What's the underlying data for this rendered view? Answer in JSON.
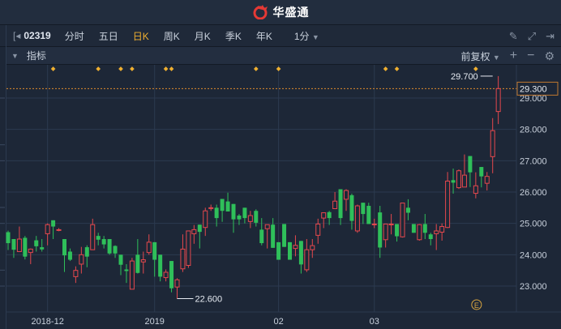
{
  "title": {
    "brand": "华盛通",
    "icon": "huasheng-logo-icon"
  },
  "toolbar": {
    "code": "02319",
    "tabs": [
      "分时",
      "五日",
      "日K",
      "周K",
      "月K",
      "季K",
      "年K"
    ],
    "active_tab": "日K",
    "interval": "1分",
    "icons": [
      "draw-pencil-icon",
      "fullscreen-icon",
      "collapse-panel-icon"
    ]
  },
  "indicator_bar": {
    "label": "指标",
    "adjust": "前复权",
    "icons": [
      "zoom-in-icon",
      "zoom-out-icon",
      "settings-gear-icon"
    ]
  },
  "colors": {
    "up": "#e5484d",
    "down": "#2fbf5a",
    "marker": "#f0b030",
    "bg": "#1d2737"
  },
  "chart_data": {
    "type": "candlestick",
    "ylim": [
      22.4,
      29.85
    ],
    "yticks": [
      "29.000",
      "28.000",
      "27.000",
      "26.000",
      "25.000",
      "24.000",
      "23.000"
    ],
    "ytick_values": [
      29,
      28,
      27,
      26,
      25,
      24,
      23
    ],
    "current_price": "29.300",
    "current_value": 29.3,
    "high_label": "29.700",
    "low_label": "22.600",
    "high_index": 86,
    "low_index": 30,
    "xlabels": [
      {
        "text": "2018-12",
        "index": 7
      },
      {
        "text": "2019",
        "index": 26
      },
      {
        "text": "02",
        "index": 48
      },
      {
        "text": "03",
        "index": 65
      }
    ],
    "event_markers": [
      8,
      16,
      20,
      22,
      28,
      29,
      44,
      48,
      67,
      69,
      83
    ],
    "earnings_marker": {
      "text": "E",
      "index": 83
    },
    "ohlc": [
      [
        24.72,
        24.77,
        24.15,
        24.37
      ],
      [
        24.5,
        24.5,
        23.9,
        24.16
      ],
      [
        24.1,
        24.9,
        24.1,
        24.5
      ],
      [
        24.54,
        24.6,
        23.85,
        23.94
      ],
      [
        24.07,
        24.2,
        23.7,
        24.18
      ],
      [
        24.46,
        24.6,
        24.1,
        24.27
      ],
      [
        24.24,
        24.5,
        24.1,
        24.17
      ],
      [
        24.67,
        25.0,
        24.3,
        24.96
      ],
      [
        25.1,
        25.1,
        24.5,
        24.9
      ],
      [
        24.8,
        24.85,
        24.75,
        24.8
      ],
      [
        24.5,
        24.5,
        23.45,
        23.98
      ],
      [
        24.1,
        24.2,
        23.8,
        23.84
      ],
      [
        23.3,
        23.63,
        23.1,
        23.5
      ],
      [
        23.7,
        24.25,
        23.4,
        24.0
      ],
      [
        24.24,
        24.3,
        23.6,
        23.94
      ],
      [
        24.16,
        25.15,
        24.16,
        24.96
      ],
      [
        24.6,
        24.7,
        24.3,
        24.48
      ],
      [
        24.5,
        24.6,
        24.2,
        24.33
      ],
      [
        24.5,
        24.5,
        24.0,
        24.04
      ],
      [
        24.28,
        24.3,
        23.9,
        24.04
      ],
      [
        24.0,
        24.0,
        23.35,
        23.68
      ],
      [
        23.53,
        23.7,
        23.1,
        23.48
      ],
      [
        22.9,
        23.9,
        22.9,
        23.8
      ],
      [
        24.0,
        24.5,
        23.4,
        23.42
      ],
      [
        23.77,
        24.1,
        23.4,
        23.84
      ],
      [
        24.07,
        24.65,
        24.0,
        24.4
      ],
      [
        24.4,
        24.4,
        23.3,
        23.84
      ],
      [
        24.0,
        24.0,
        23.15,
        23.3
      ],
      [
        23.27,
        23.53,
        23.15,
        23.44
      ],
      [
        23.8,
        23.8,
        22.8,
        22.93
      ],
      [
        22.97,
        23.25,
        22.6,
        23.2
      ],
      [
        23.55,
        24.65,
        23.45,
        24.18
      ],
      [
        23.66,
        24.76,
        23.58,
        24.76
      ],
      [
        24.67,
        24.95,
        24.35,
        24.8
      ],
      [
        24.96,
        24.96,
        24.2,
        24.73
      ],
      [
        24.87,
        25.5,
        24.6,
        25.4
      ],
      [
        25.5,
        25.6,
        25.4,
        25.5
      ],
      [
        25.5,
        25.6,
        24.9,
        25.17
      ],
      [
        25.78,
        25.78,
        25.05,
        25.4
      ],
      [
        25.7,
        25.98,
        25.38,
        25.38
      ],
      [
        25.62,
        25.62,
        24.7,
        25.13
      ],
      [
        25.25,
        25.3,
        24.95,
        25.13
      ],
      [
        25.5,
        25.5,
        25.0,
        25.17
      ],
      [
        25.06,
        25.4,
        24.85,
        25.25
      ],
      [
        25.4,
        25.45,
        24.9,
        25.02
      ],
      [
        24.8,
        25.17,
        24.3,
        24.37
      ],
      [
        24.83,
        24.96,
        24.2,
        24.96
      ],
      [
        24.96,
        25.17,
        24.22,
        24.22
      ],
      [
        24.4,
        24.4,
        23.84,
        23.84
      ],
      [
        24.98,
        24.98,
        24.25,
        24.25
      ],
      [
        24.4,
        24.4,
        23.84,
        23.84
      ],
      [
        24.2,
        24.62,
        23.95,
        24.3
      ],
      [
        24.44,
        24.44,
        23.4,
        23.69
      ],
      [
        23.52,
        24.5,
        23.45,
        24.16
      ],
      [
        24.16,
        24.5,
        23.9,
        24.29
      ],
      [
        24.62,
        25.15,
        24.35,
        24.98
      ],
      [
        25.17,
        25.35,
        24.85,
        25.34
      ],
      [
        25.36,
        25.4,
        24.95,
        25.17
      ],
      [
        25.47,
        26.0,
        25.47,
        25.71
      ],
      [
        26.09,
        26.09,
        24.95,
        25.17
      ],
      [
        25.77,
        26.09,
        25.4,
        26.05
      ],
      [
        25.9,
        25.95,
        24.8,
        25.08
      ],
      [
        24.76,
        25.6,
        24.7,
        25.56
      ],
      [
        25.66,
        25.66,
        24.98,
        25.3
      ],
      [
        25.56,
        25.66,
        24.98,
        24.98
      ],
      [
        24.98,
        25.15,
        24.85,
        24.98
      ],
      [
        25.35,
        25.56,
        23.9,
        24.23
      ],
      [
        24.48,
        24.98,
        24.23,
        24.98
      ],
      [
        24.98,
        25.3,
        24.65,
        24.98
      ],
      [
        24.98,
        24.98,
        24.42,
        24.59
      ],
      [
        24.57,
        25.65,
        24.55,
        25.65
      ],
      [
        25.5,
        25.77,
        25.1,
        25.34
      ],
      [
        24.98,
        24.98,
        24.7,
        24.7
      ],
      [
        24.48,
        24.98,
        24.45,
        24.96
      ],
      [
        24.98,
        25.3,
        24.5,
        24.7
      ],
      [
        24.65,
        24.7,
        24.3,
        24.5
      ],
      [
        24.67,
        24.98,
        24.15,
        24.76
      ],
      [
        24.72,
        25.0,
        24.45,
        24.9
      ],
      [
        24.87,
        26.64,
        24.85,
        26.35
      ],
      [
        26.38,
        26.75,
        25.95,
        26.3
      ],
      [
        26.14,
        26.72,
        26.1,
        26.68
      ],
      [
        26.16,
        27.2,
        26.16,
        26.54
      ],
      [
        27.15,
        27.15,
        26.16,
        26.63
      ],
      [
        25.96,
        26.63,
        25.8,
        26.2
      ],
      [
        26.8,
        26.8,
        26.15,
        26.5
      ],
      [
        26.28,
        26.64,
        26.05,
        26.5
      ],
      [
        27.13,
        28.36,
        26.6,
        27.96
      ],
      [
        28.57,
        29.7,
        28.17,
        29.3
      ]
    ]
  }
}
